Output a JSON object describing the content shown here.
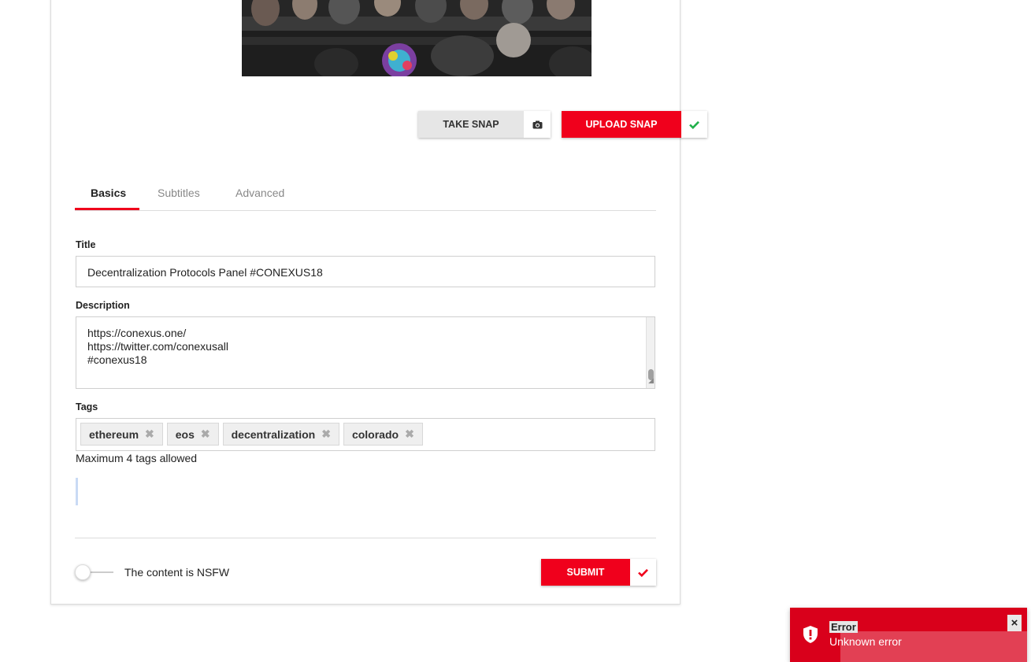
{
  "snap": {
    "take_label": "TAKE SNAP",
    "take_icon": "camera-icon",
    "upload_label": "UPLOAD SNAP",
    "upload_icon": "check-icon"
  },
  "tabs": [
    {
      "label": "Basics",
      "active": true
    },
    {
      "label": "Subtitles",
      "active": false
    },
    {
      "label": "Advanced",
      "active": false
    }
  ],
  "form": {
    "title_label": "Title",
    "title_value": "Decentralization Protocols Panel #CONEXUS18",
    "description_label": "Description",
    "description_lines": [
      "https://conexus.one/",
      "https://twitter.com/conexusall",
      "#conexus18"
    ],
    "tags_label": "Tags",
    "tags": [
      "ethereum",
      "eos",
      "decentralization",
      "colorado"
    ],
    "tags_hint": "Maximum 4 tags allowed",
    "nsfw_label": "The content is NSFW",
    "nsfw_checked": false,
    "submit_label": "SUBMIT"
  },
  "toast": {
    "title": "Error",
    "message": "Unknown error",
    "icon": "shield-alert-icon",
    "close": "×"
  },
  "colors": {
    "accent": "#f0001c",
    "success": "#22b14c",
    "toast_bg": "#d9001b"
  }
}
